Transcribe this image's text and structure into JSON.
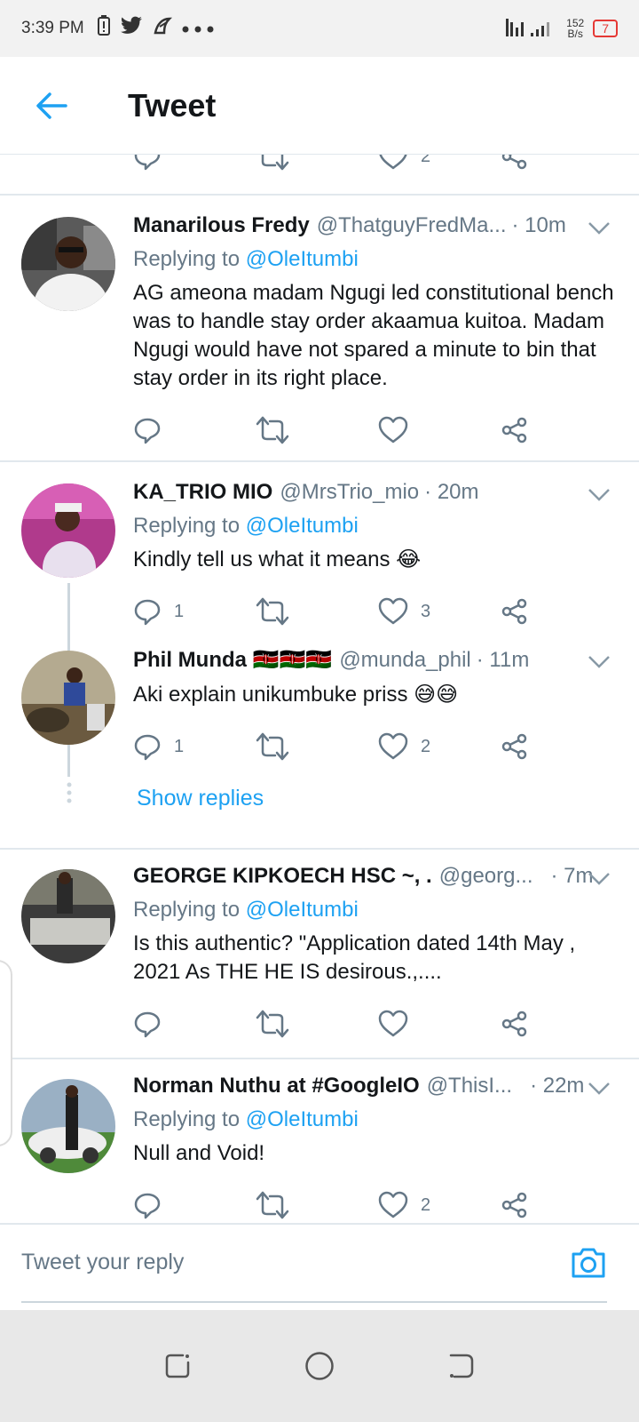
{
  "status_bar": {
    "time": "3:39 PM",
    "net_speed_value": "152",
    "net_speed_unit": "B/s",
    "battery": "7",
    "icons": [
      "battery-alert-icon",
      "twitter-icon",
      "app-icon",
      "more-dots-icon"
    ]
  },
  "header": {
    "title": "Tweet",
    "back_icon": "back-arrow-icon"
  },
  "partial_tweet": {
    "like_count": "2"
  },
  "tweets": [
    {
      "name": "Manarilous Fredy",
      "handle": "@ThatguyFredMa...",
      "time": "· 10m",
      "replying_label": "Replying to",
      "replying_to": "@OleItumbi",
      "text": "AG ameona madam Ngugi led constitutional bench was to handle stay order akaamua kuitoa. Madam Ngugi would have not spared a minute to bin that stay order in its right place.",
      "reply_count": "",
      "like_count": ""
    },
    {
      "name": "KA_TRIO MIO",
      "handle": "@MrsTrio_mio",
      "time": "· 20m",
      "replying_label": "Replying to",
      "replying_to": "@OleItumbi",
      "text": "Kindly tell us what it means 😂",
      "reply_count": "1",
      "like_count": "3"
    },
    {
      "name": "Phil Munda 🇰🇪🇰🇪🇰🇪",
      "handle": "@munda_phil",
      "time": "· 11m",
      "text": "Aki explain unikumbuke priss 😅😅",
      "reply_count": "1",
      "like_count": "2",
      "show_replies": "Show replies"
    },
    {
      "name": "GEORGE KIPKOECH HSC ~, .",
      "handle": "@georg...",
      "time": "· 7m",
      "replying_label": "Replying to",
      "replying_to": "@OleItumbi",
      "text": "Is this authentic? \"Application dated 14th May , 2021 As THE HE IS desirous.,....",
      "reply_count": "",
      "like_count": ""
    },
    {
      "name": "Norman Nuthu at #GoogleIO",
      "handle": "@ThisI...",
      "time": "· 22m",
      "replying_label": "Replying to",
      "replying_to": "@OleItumbi",
      "text": "Null and Void!",
      "reply_count": "",
      "like_count": "2"
    }
  ],
  "reply_bar": {
    "placeholder": "Tweet your reply",
    "camera_icon": "camera-icon"
  },
  "colors": {
    "accent": "#1da1f2",
    "secondary_text": "#657786",
    "divider": "#e1e8ed"
  }
}
